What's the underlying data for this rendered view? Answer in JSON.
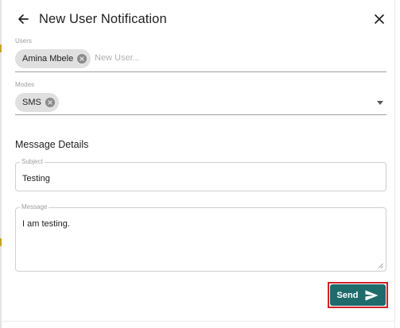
{
  "dialog": {
    "title": "New User Notification"
  },
  "users_field": {
    "label": "Users",
    "chips": [
      "Amina Mbele"
    ],
    "placeholder": "New User..."
  },
  "modes_field": {
    "label": "Modes",
    "chips": [
      "SMS"
    ]
  },
  "message_details": {
    "heading": "Message Details",
    "subject_label": "Subject",
    "subject_value": "Testing",
    "message_label": "Message",
    "message_value": "I am testing."
  },
  "actions": {
    "send_label": "Send"
  },
  "icons": {
    "back": "arrow-left-icon",
    "close": "close-icon",
    "chip_remove": "cancel-circle-icon",
    "dropdown": "caret-down-icon",
    "send": "send-icon",
    "resize": "resize-grip-icon"
  },
  "colors": {
    "send_button": "#1f6b6b",
    "highlight_outline": "#d32027",
    "chip_bg": "#e0e0e0"
  }
}
